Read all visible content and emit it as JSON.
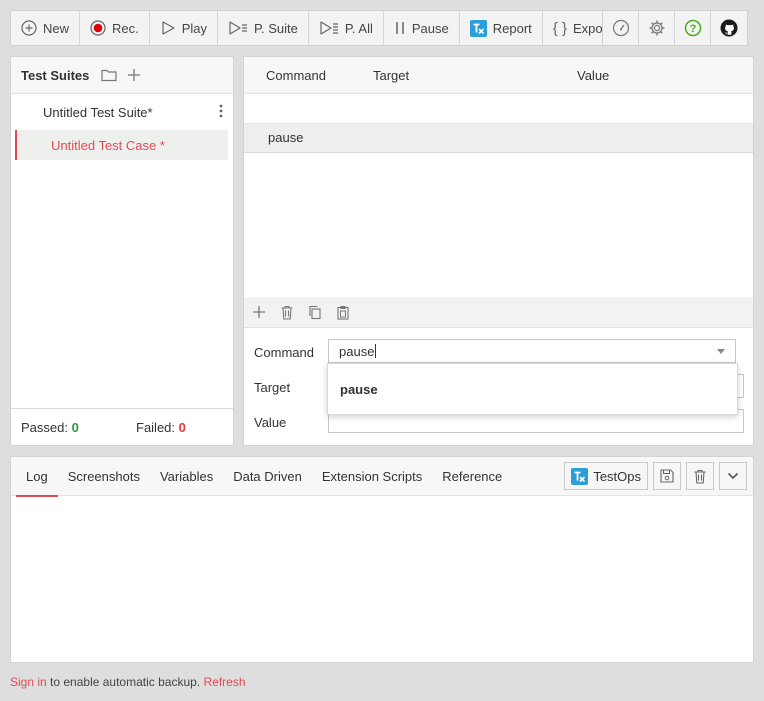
{
  "toolbar": {
    "new_label": "New",
    "rec_label": "Rec.",
    "play_label": "Play",
    "play_suite_label": "P. Suite",
    "play_all_label": "P. All",
    "pause_label": "Pause",
    "report_label": "Report",
    "export_label": "Export"
  },
  "toolbar_right": {
    "icons": [
      "speedometer-icon",
      "gear-icon",
      "help-icon",
      "github-icon"
    ]
  },
  "test_suites": {
    "title": "Test Suites",
    "suite_name": "Untitled Test Suite*",
    "case_name": "Untitled Test Case *",
    "passed_label": "Passed:",
    "passed_count": "0",
    "failed_label": "Failed:",
    "failed_count": "0"
  },
  "grid": {
    "headers": {
      "command": "Command",
      "target": "Target",
      "value": "Value"
    },
    "rows": [
      {
        "command": "pause",
        "target": "",
        "value": ""
      }
    ]
  },
  "editor": {
    "command_label": "Command",
    "command_value": "pause",
    "target_label": "Target",
    "value_label": "Value",
    "suggestion": "pause"
  },
  "bottom": {
    "tabs": [
      "Log",
      "Screenshots",
      "Variables",
      "Data Driven",
      "Extension Scripts",
      "Reference"
    ],
    "testops_label": "TestOps"
  },
  "status": {
    "sign_in": "Sign in",
    "middle": " to enable automatic backup. ",
    "refresh": "Refresh"
  },
  "colors": {
    "accent": "#e24b53",
    "passed": "#2f9a38",
    "failed": "#e23b3b",
    "help": "#4caf1a",
    "report_brand": "#2a9fd8"
  }
}
